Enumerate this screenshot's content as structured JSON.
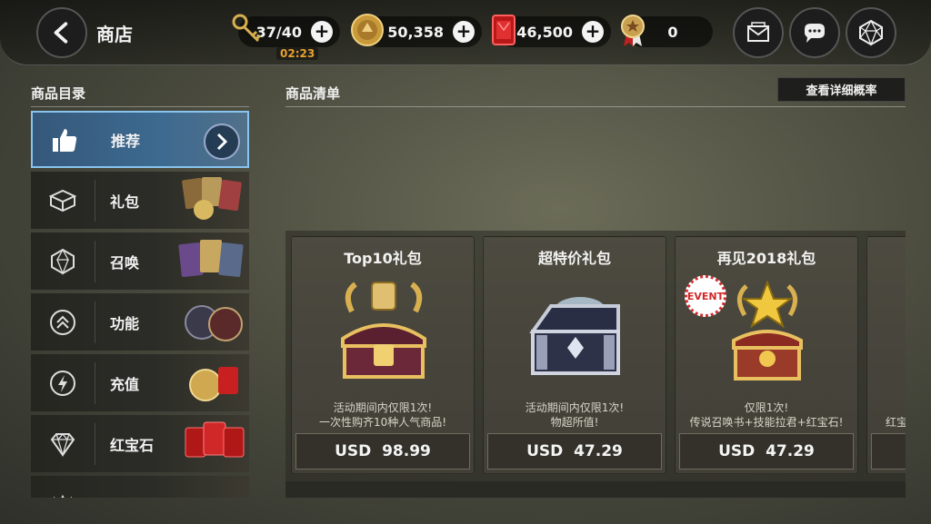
{
  "header": {
    "title": "商店",
    "keys": {
      "value": "37/40",
      "timer": "02:23"
    },
    "gold": {
      "value": "50,358"
    },
    "rubies": {
      "value": "46,500"
    },
    "medal": {
      "value": "0"
    },
    "plus_label": "+"
  },
  "catalog": {
    "title": "商品目录",
    "items": [
      {
        "label": "推荐",
        "icon": "thumbs-up-icon"
      },
      {
        "label": "礼包",
        "icon": "box-icon"
      },
      {
        "label": "召唤",
        "icon": "d20-icon"
      },
      {
        "label": "功能",
        "icon": "chevrons-up-icon"
      },
      {
        "label": "充值",
        "icon": "lightning-icon"
      },
      {
        "label": "红宝石",
        "icon": "diamond-icon"
      }
    ]
  },
  "products": {
    "title": "商品清单",
    "rate_button": "查看详细概率",
    "event_badge": "EVENT",
    "cards": [
      {
        "name": "Top10礼包",
        "desc_1": "活动期间内仅限1次!",
        "desc_2": "一次性购齐10种人气商品!",
        "price": "USD  98.99"
      },
      {
        "name": "超特价礼包",
        "desc_1": "活动期间内仅限1次!",
        "desc_2": "物超所值!",
        "price": "USD  47.29"
      },
      {
        "name": "再见2018礼包",
        "desc_1": "仅限1次!",
        "desc_2": "传说召唤书+技能拉君+红宝石!",
        "price": "USD  47.29"
      }
    ],
    "partial_card_text": "红宝"
  },
  "colors": {
    "active_border": "#88c4ee",
    "gold": "#e0b040",
    "ruby": "#d02020",
    "timer": "#e8a030"
  }
}
